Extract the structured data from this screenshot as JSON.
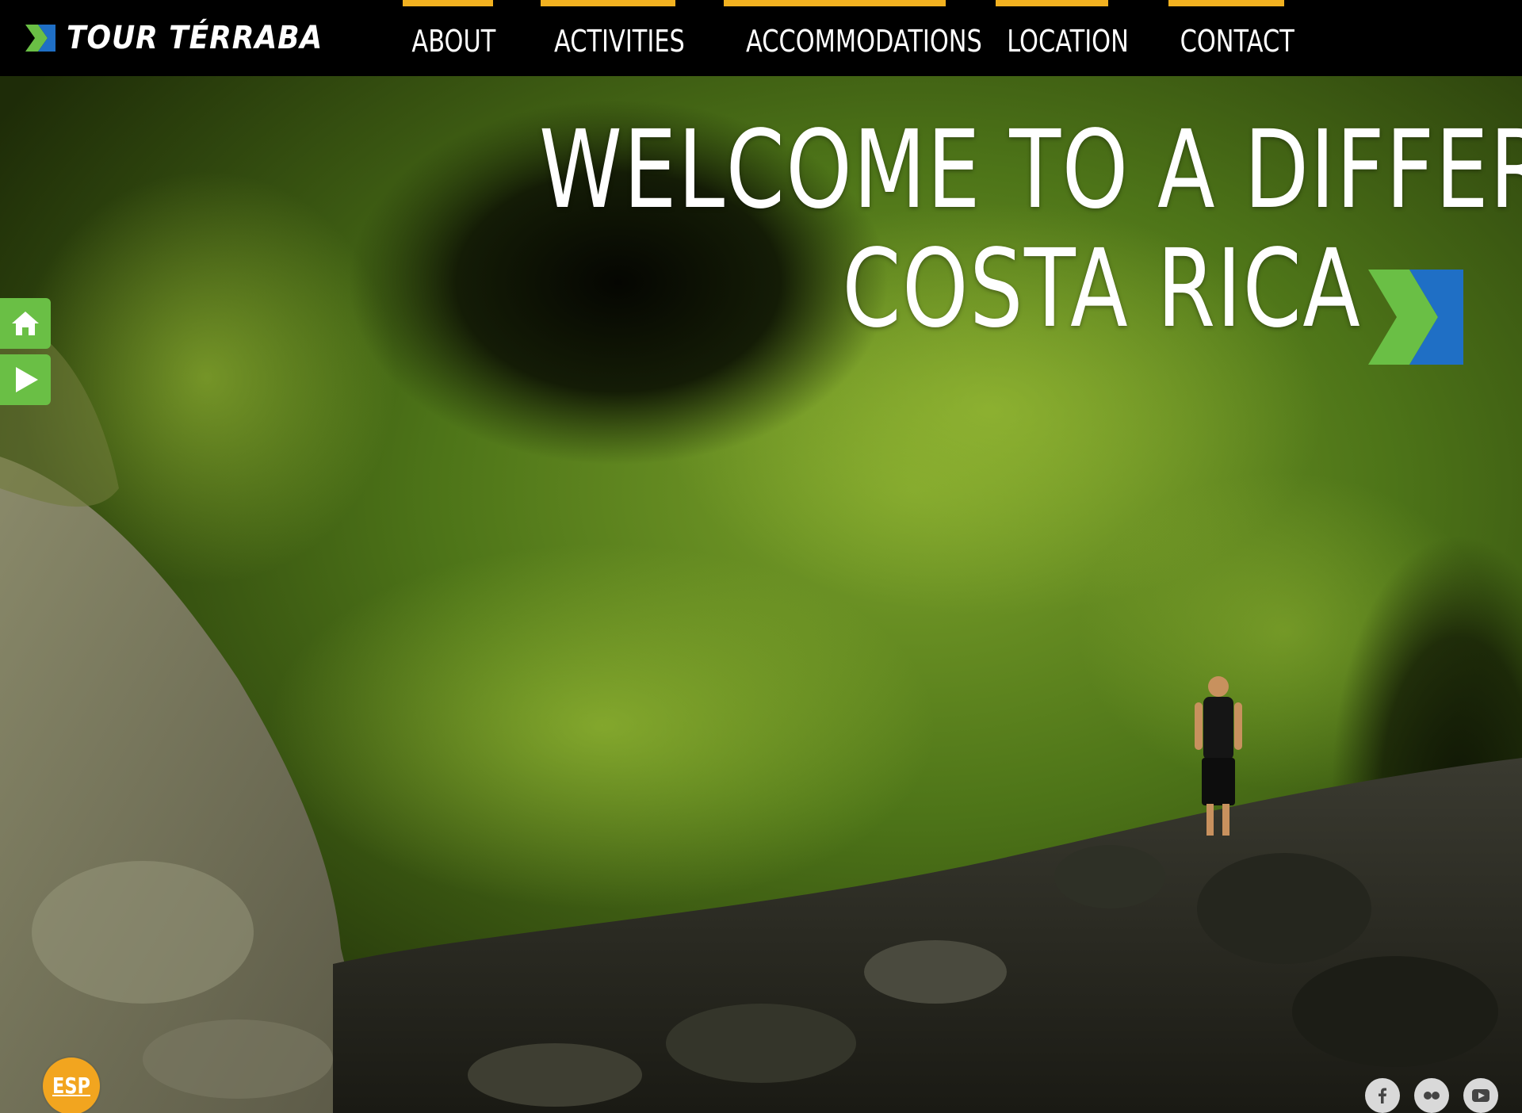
{
  "brand": {
    "name": "TOUR TÉRRABA"
  },
  "nav": {
    "items": [
      {
        "label": "ABOUT"
      },
      {
        "label": "ACTIVITIES"
      },
      {
        "label": "ACCOMMODATIONS"
      },
      {
        "label": "LOCATION"
      },
      {
        "label": "CONTACT"
      }
    ]
  },
  "hero": {
    "headline_line1": "WELCOME TO A DIFFERENT",
    "headline_line2": "COSTA RICA"
  },
  "side_tabs": {
    "home_icon": "home-icon",
    "play_icon": "play-icon"
  },
  "language": {
    "label": "ESP"
  },
  "social": {
    "icons": [
      "facebook-icon",
      "flickr-icon",
      "youtube-icon"
    ]
  },
  "colors": {
    "accent_yellow": "#f2b120",
    "brand_green": "#6abf45",
    "brand_blue": "#1f6fc5",
    "lang_orange": "#f2a51f",
    "header_bg": "#000000"
  }
}
